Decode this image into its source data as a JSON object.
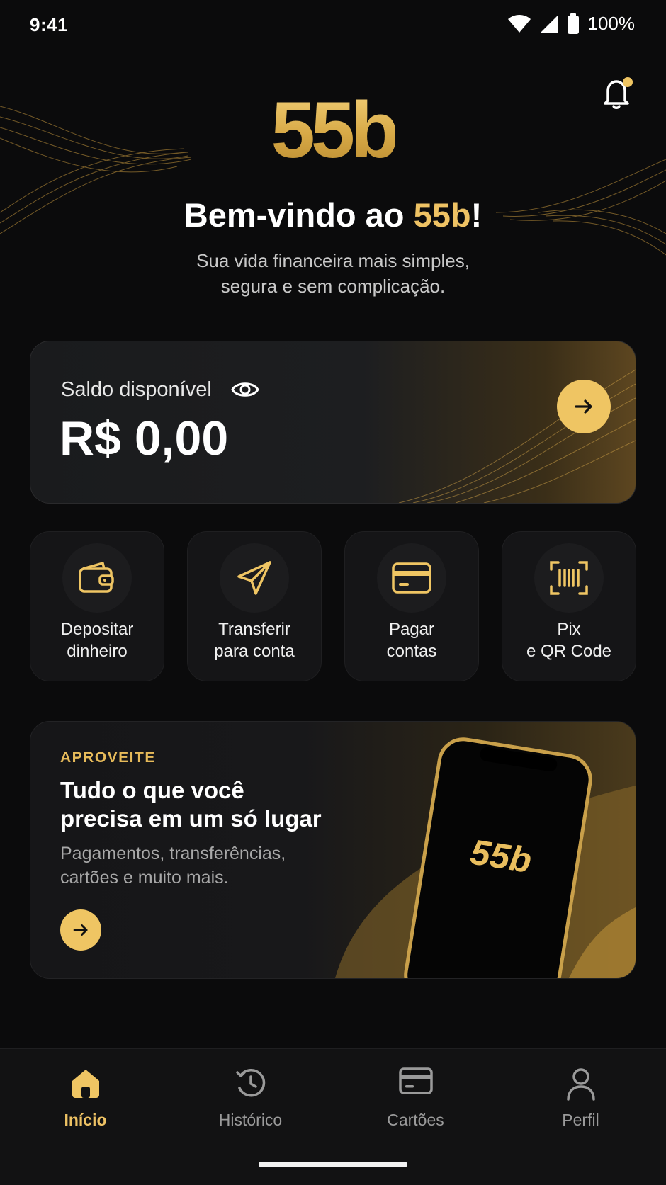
{
  "status_bar": {
    "time": "9:41",
    "battery": "100%"
  },
  "header": {
    "logo": "55b",
    "welcome_prefix": "Bem-vindo ao ",
    "welcome_brand": "55b",
    "welcome_suffix": "!",
    "subtitle_line1": "Sua vida financeira mais simples,",
    "subtitle_line2": "segura e sem complicação."
  },
  "balance": {
    "label": "Saldo disponível",
    "value": "R$ 0,00"
  },
  "actions": [
    {
      "line1": "Depositar",
      "line2": "dinheiro",
      "icon": "wallet-icon"
    },
    {
      "line1": "Transferir",
      "line2": "para conta",
      "icon": "paper-plane-icon"
    },
    {
      "line1": "Pagar",
      "line2": "contas",
      "icon": "card-icon"
    },
    {
      "line1": "Pix",
      "line2": "e QR Code",
      "icon": "qr-scan-icon"
    }
  ],
  "promo": {
    "eyebrow": "APROVEITE",
    "title_line1": "Tudo o que você",
    "title_line2": "precisa em um só lugar",
    "desc_line1": "Pagamentos, transferências,",
    "desc_line2": "cartões e muito mais.",
    "phone_logo": "55b"
  },
  "nav": [
    {
      "label": "Início",
      "icon": "home-icon",
      "active": true
    },
    {
      "label": "Histórico",
      "icon": "history-icon",
      "active": false
    },
    {
      "label": "Cartões",
      "icon": "card-icon",
      "active": false
    },
    {
      "label": "Perfil",
      "icon": "user-icon",
      "active": false
    }
  ],
  "colors": {
    "accent": "#efc563",
    "background": "#0b0b0c",
    "card": "#151517"
  }
}
